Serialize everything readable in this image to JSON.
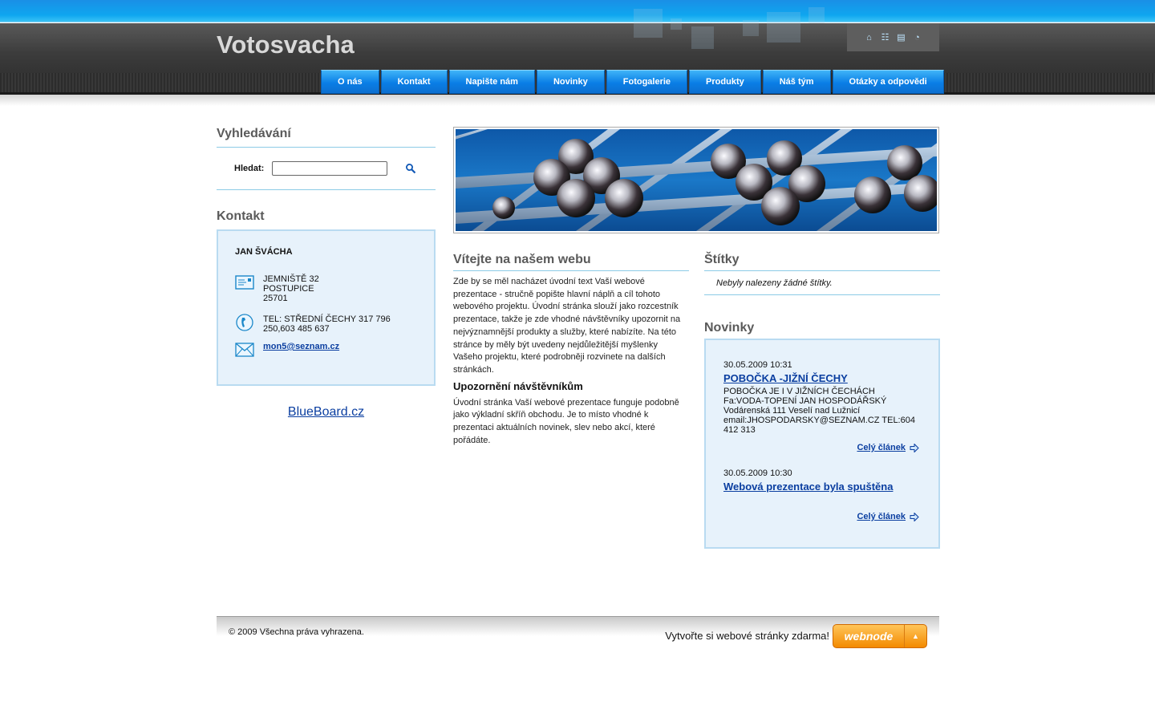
{
  "site": {
    "title": "Votosvacha"
  },
  "tools": [
    "home-icon",
    "sitemap-icon",
    "print-icon",
    "rss-icon"
  ],
  "nav": [
    "O nás",
    "Kontakt",
    "Napište nám",
    "Novinky",
    "Fotogalerie",
    "Produkty",
    "Náš tým",
    "Otázky a odpovědi"
  ],
  "search": {
    "heading": "Vyhledávání",
    "label": "Hledat:",
    "value": "",
    "placeholder": ""
  },
  "contact": {
    "heading": "Kontakt",
    "name": "JAN ŠVÁCHA",
    "address": [
      "JEMNIŠTĚ 32",
      "POSTUPICE",
      "25701"
    ],
    "phone": [
      "TEL: STŘEDNÍ ČECHY 317 796",
      "250,603 485 637"
    ],
    "email": "mon5@seznam.cz"
  },
  "blueboard": "BlueBoard.cz",
  "welcome": {
    "heading": "Vítejte na našem webu",
    "text": "Zde by se měl nacházet úvodní text Vaší webové prezentace - stručně popište hlavní náplň a cíl tohoto webového projektu. Úvodní stránka slouží jako rozcestník prezentace, takže je zde vhodné návštěvníky upozornit na nejvýznamnější produkty a služby, které nabízíte. Na této stránce by měly být uvedeny nejdůležitější myšlenky Vašeho projektu, které podrobněji rozvinete na dalších stránkách.",
    "subheading": "Upozornění návštěvníkům",
    "text2": "Úvodní stránka Vaší webové prezentace funguje podobně jako výkladní skříň obchodu. Je to místo vhodné k prezentaci aktuálních novinek, slev nebo akcí, které pořádáte."
  },
  "tags": {
    "heading": "Štítky",
    "empty": "Nebyly nalezeny žádné štítky."
  },
  "news": {
    "heading": "Novinky",
    "items": [
      {
        "date": "30.05.2009 10:31",
        "title": "POBOČKA -JIŽNÍ ČECHY",
        "lines": [
          "POBOČKA JE I V JIŽNÍCH ČECHÁCH",
          "Fa:VODA-TOPENÍ JAN HOSPODÁŘSKÝ",
          "Vodárenská 111 Veselí nad Lužnicí",
          "email:JHOSPODARSKY@SEZNAM.CZ TEL:604",
          "412 313"
        ],
        "more": "Celý článek"
      },
      {
        "date": "30.05.2009 10:30",
        "title": "Webová prezentace byla spuštěna",
        "lines": [],
        "more": "Celý článek"
      }
    ]
  },
  "footer": {
    "copyright": "© 2009 Všechna práva vyhrazena.",
    "promo": "Vytvořte si webové stránky zdarma!",
    "logo": "webnode",
    "logo_arrow": "▲"
  }
}
